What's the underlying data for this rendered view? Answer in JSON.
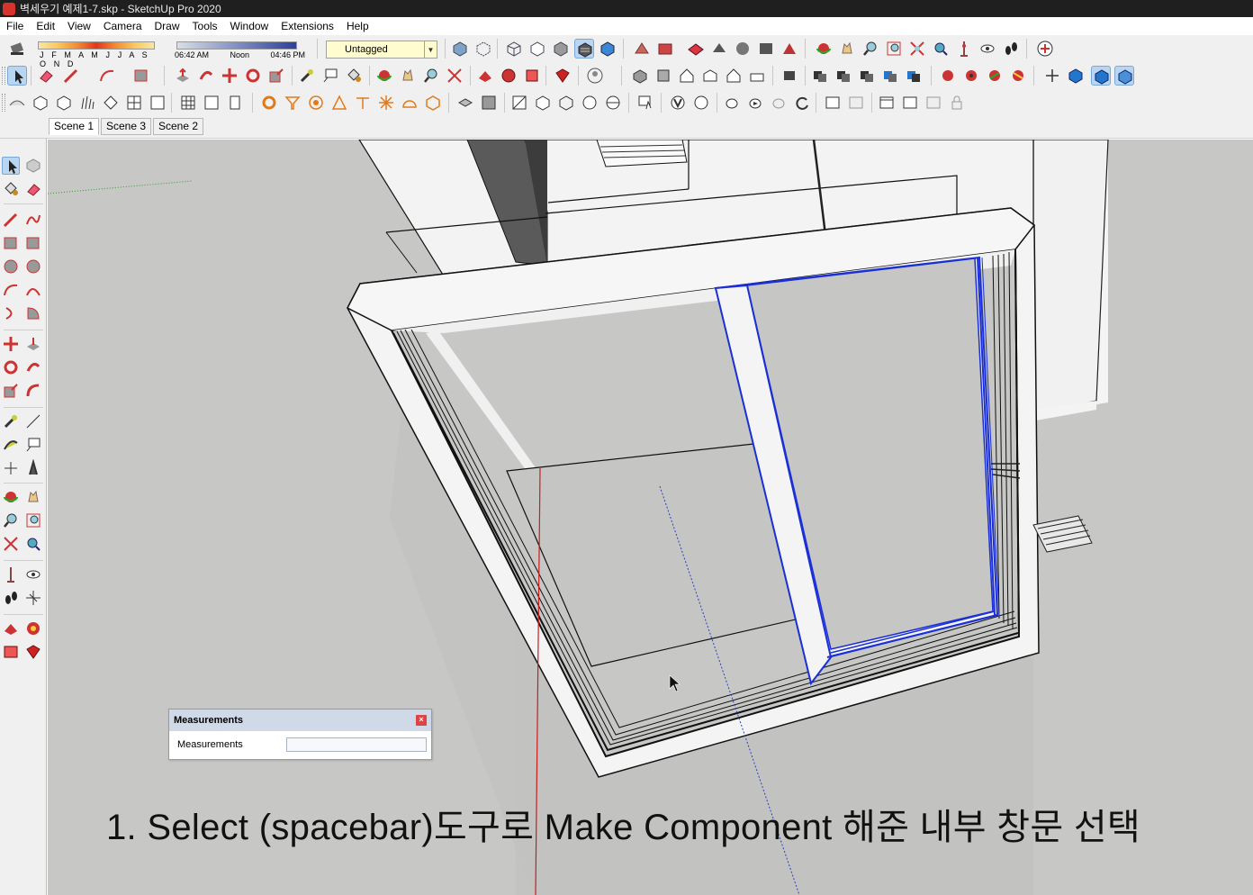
{
  "window": {
    "title": "벽세우기 예제1-7.skp - SketchUp Pro 2020"
  },
  "menu": [
    "File",
    "Edit",
    "View",
    "Camera",
    "Draw",
    "Tools",
    "Window",
    "Extensions",
    "Help"
  ],
  "shadows": {
    "months": "J F M A M J J A S O N D",
    "time_start": "06:42 AM",
    "time_mid": "Noon",
    "time_end": "04:46 PM"
  },
  "tag": {
    "selected": "Untagged"
  },
  "scenes": [
    "Scene 1",
    "Scene 3",
    "Scene 2"
  ],
  "measurements": {
    "title": "Measurements",
    "label": "Measurements",
    "value": ""
  },
  "caption": "1. Select (spacebar)도구로 Make Component 해준 내부 창문 선택",
  "colors": {
    "viewport": "#c8c8c6",
    "selection": "#1a2fd6",
    "axis_red": "#c81e1e",
    "axis_green": "#2ea02e",
    "axis_blue": "#2e3fc4"
  }
}
